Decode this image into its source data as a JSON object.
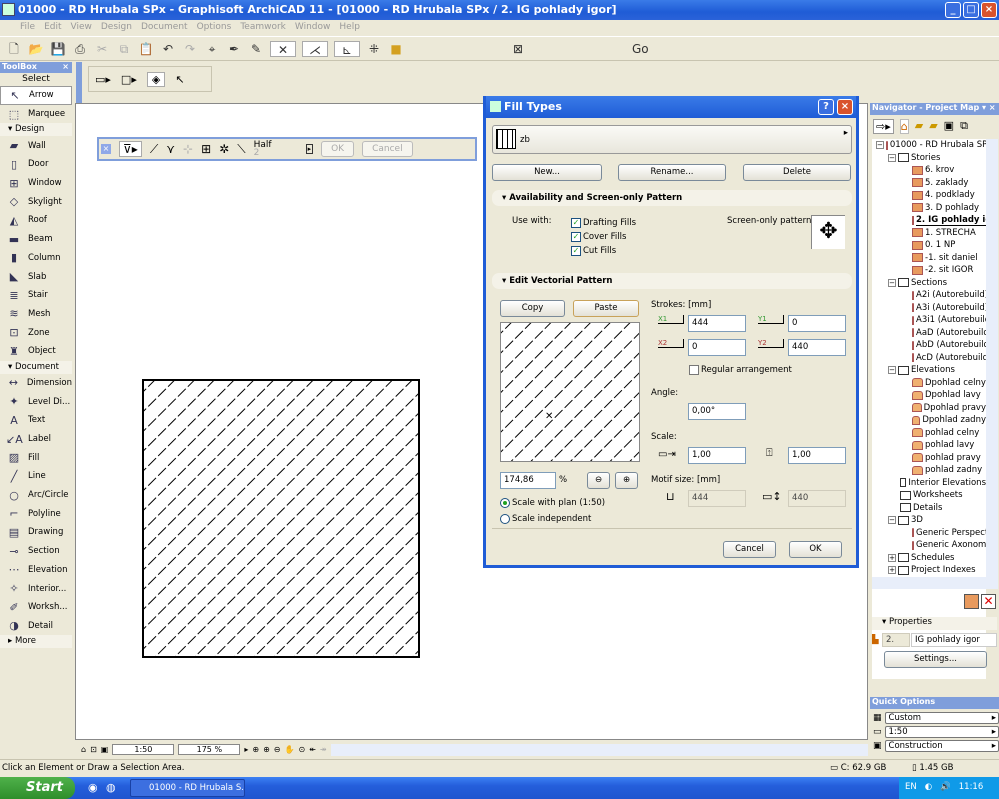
{
  "window": {
    "title": "01000 - RD Hrubala SPx - Graphisoft ArchiCAD 11 - [01000 - RD Hrubala SPx / 2. IG pohlady igor]"
  },
  "menu": [
    "File",
    "Edit",
    "View",
    "Design",
    "Document",
    "Options",
    "Teamwork",
    "Window",
    "Help"
  ],
  "toolbox": {
    "title": "ToolBox",
    "select_label": "Select",
    "select_items": [
      "Arrow",
      "Marquee"
    ],
    "groups": [
      {
        "label": "Design",
        "items": [
          "Wall",
          "Door",
          "Window",
          "Skylight",
          "Roof",
          "Beam",
          "Column",
          "Slab",
          "Stair",
          "Mesh",
          "Zone",
          "Object"
        ]
      },
      {
        "label": "Document",
        "items": [
          "Dimension",
          "Level Di...",
          "Text",
          "Label",
          "Fill",
          "Line",
          "Arc/Circle",
          "Polyline",
          "Drawing",
          "Section",
          "Elevation",
          "Interior...",
          "Worksh...",
          "Detail"
        ]
      }
    ],
    "more_label": "More"
  },
  "floatbar": {
    "pen_label": "Half",
    "pen_num": "2",
    "ok": "OK",
    "cancel": "Cancel"
  },
  "dialog": {
    "title": "Fill Types",
    "fill_name": "zb",
    "new": "New...",
    "rename": "Rename...",
    "delete": "Delete",
    "section1": "Availability and Screen-only Pattern",
    "use_with": "Use with:",
    "checks": [
      {
        "label": "Drafting Fills",
        "checked": true
      },
      {
        "label": "Cover Fills",
        "checked": true
      },
      {
        "label": "Cut Fills",
        "checked": true
      }
    ],
    "screen_only": "Screen-only pattern:",
    "section2": "Edit Vectorial Pattern",
    "copy": "Copy",
    "paste": "Paste",
    "strokes_label": "Strokes: [mm]",
    "x1_label": "X1",
    "x1": "444",
    "y1_label": "Y1",
    "y1": "0",
    "x2_label": "X2",
    "x2": "0",
    "y2_label": "Y2",
    "y2": "440",
    "regular": "Regular arrangement",
    "regular_checked": false,
    "angle_label": "Angle:",
    "angle": "0,00°",
    "scale_label": "Scale:",
    "scale_x": "1,00",
    "scale_y": "1,00",
    "motif_label": "Motif size: [mm]",
    "motif_w": "444",
    "motif_h": "440",
    "zoom": "174,86",
    "zoom_unit": "%",
    "scale_with_plan": "Scale with plan (1:50)",
    "scale_independent": "Scale independent",
    "cancel": "Cancel",
    "ok": "OK"
  },
  "navigator": {
    "title": "Navigator - Project Map",
    "root": "01000 - RD Hrubala SPx",
    "stories_label": "Stories",
    "stories": [
      "6. krov",
      "5. zaklady",
      "4. podklady",
      "3. D pohlady",
      "2. IG pohlady igor",
      "1. STRECHA",
      "0. 1 NP",
      "-1. sit daniel",
      "-2. sit IGOR"
    ],
    "sections_label": "Sections",
    "sections": [
      "A2i (Autorebuild)",
      "A3i (Autorebuild)",
      "A3i1 (Autorebuild)",
      "AaD (Autorebuild)",
      "AbD (Autorebuild)",
      "AcD (Autorebuild)"
    ],
    "elevations_label": "Elevations",
    "elevations": [
      "Dpohlad celny",
      "Dpohlad lavy",
      "Dpohlad pravy",
      "Dpohlad zadny",
      "pohlad celny",
      "pohlad lavy",
      "pohlad pravy",
      "pohlad zadny"
    ],
    "other": [
      "Interior Elevations",
      "Worksheets",
      "Details"
    ],
    "threed_label": "3D",
    "threed": [
      "Generic Perspective",
      "Generic Axonometry"
    ],
    "tail": [
      "Schedules",
      "Project Indexes"
    ],
    "properties_label": "Properties",
    "prop_num": "2.",
    "prop_name": "IG pohlady igor",
    "settings": "Settings..."
  },
  "quick_options": {
    "title": "Quick Options",
    "values": [
      "Custom",
      "1:50",
      "Construction"
    ]
  },
  "bottombar": {
    "scale": "1:50",
    "zoom": "175 %"
  },
  "status": {
    "message": "Click an Element or Draw a Selection Area.",
    "disk": "C: 62.9 GB",
    "memory": "1.45 GB"
  },
  "taskbar": {
    "start": "Start",
    "app": "01000 - RD Hrubala S...",
    "lang": "EN",
    "clock": "11:16"
  },
  "colors": {
    "title_blue": "#1f5cd6",
    "panel_blue": "#7f9edb",
    "face": "#ece9d8",
    "story_orange": "#e89a5e"
  }
}
